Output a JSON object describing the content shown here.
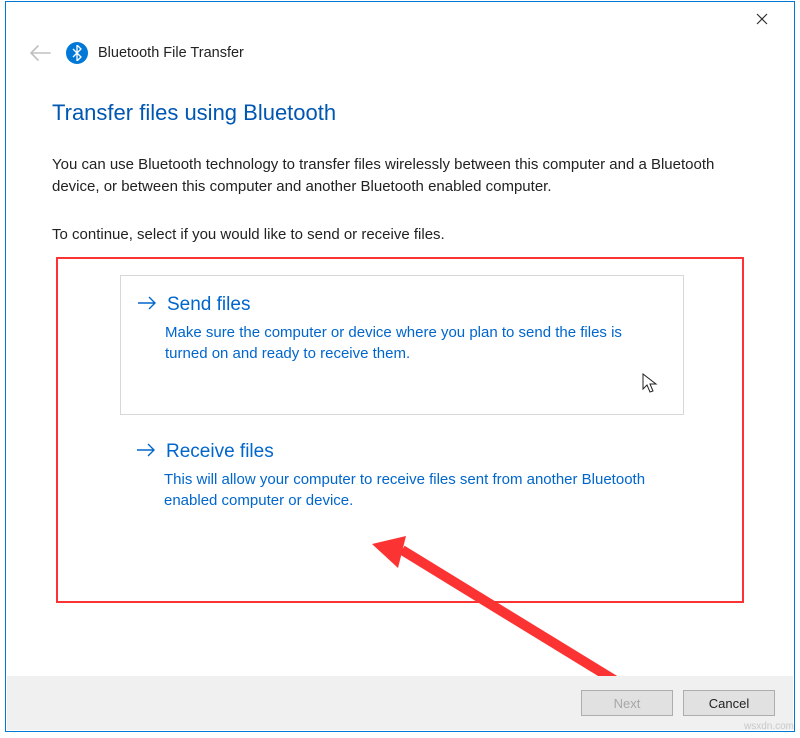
{
  "wizard": {
    "title": "Bluetooth File Transfer",
    "heading": "Transfer files using Bluetooth",
    "description": "You can use Bluetooth technology to transfer files wirelessly between this computer and a Bluetooth device, or between this computer and another Bluetooth enabled computer.",
    "instruction": "To continue, select if you would like to send or receive files."
  },
  "options": {
    "send": {
      "title": "Send files",
      "description": "Make sure the computer or device where you plan to send the files is turned on and ready to receive them."
    },
    "receive": {
      "title": "Receive files",
      "description": "This will allow your computer to receive files sent from another Bluetooth enabled computer or device."
    }
  },
  "buttons": {
    "next": "Next",
    "cancel": "Cancel"
  },
  "watermark": "wsxdn.com"
}
